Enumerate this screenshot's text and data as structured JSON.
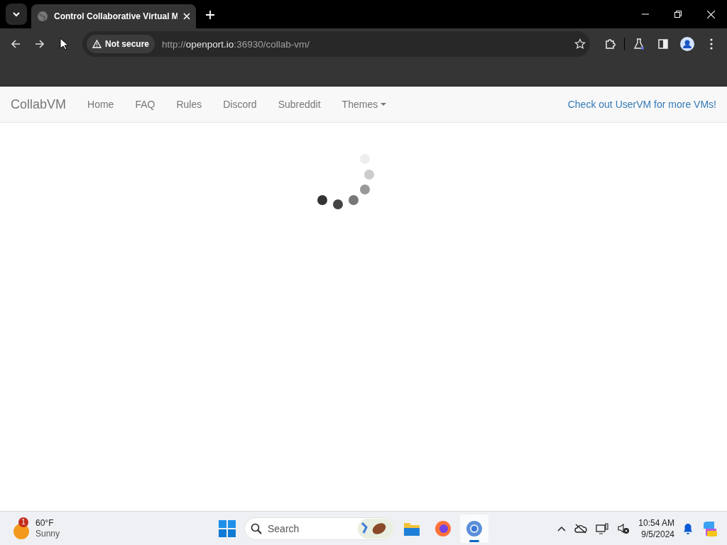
{
  "browser": {
    "tab": {
      "title": "Control Collaborative Virtual M",
      "selected": true
    },
    "address": {
      "security": "Not secure",
      "scheme": "http://",
      "host": "openport.io",
      "path": ":36930/collab-vm/"
    }
  },
  "navbar": {
    "brand": "CollabVM",
    "links": [
      {
        "label": "Home"
      },
      {
        "label": "FAQ"
      },
      {
        "label": "Rules"
      },
      {
        "label": "Discord"
      },
      {
        "label": "Subreddit"
      },
      {
        "label": "Themes",
        "kind": "dropdown"
      }
    ],
    "promo": "Check out UserVM for more VMs!"
  },
  "taskbar": {
    "weather": {
      "badge": "1",
      "temp": "60°F",
      "condition": "Sunny"
    },
    "search": {
      "placeholder": "Search"
    },
    "apps": [
      {
        "kind": "folder",
        "selected": false
      },
      {
        "kind": "firefox",
        "selected": false
      },
      {
        "kind": "chrome",
        "selected": true
      }
    ],
    "clock": {
      "time": "10:54 AM",
      "date": "9/5/2024"
    }
  }
}
